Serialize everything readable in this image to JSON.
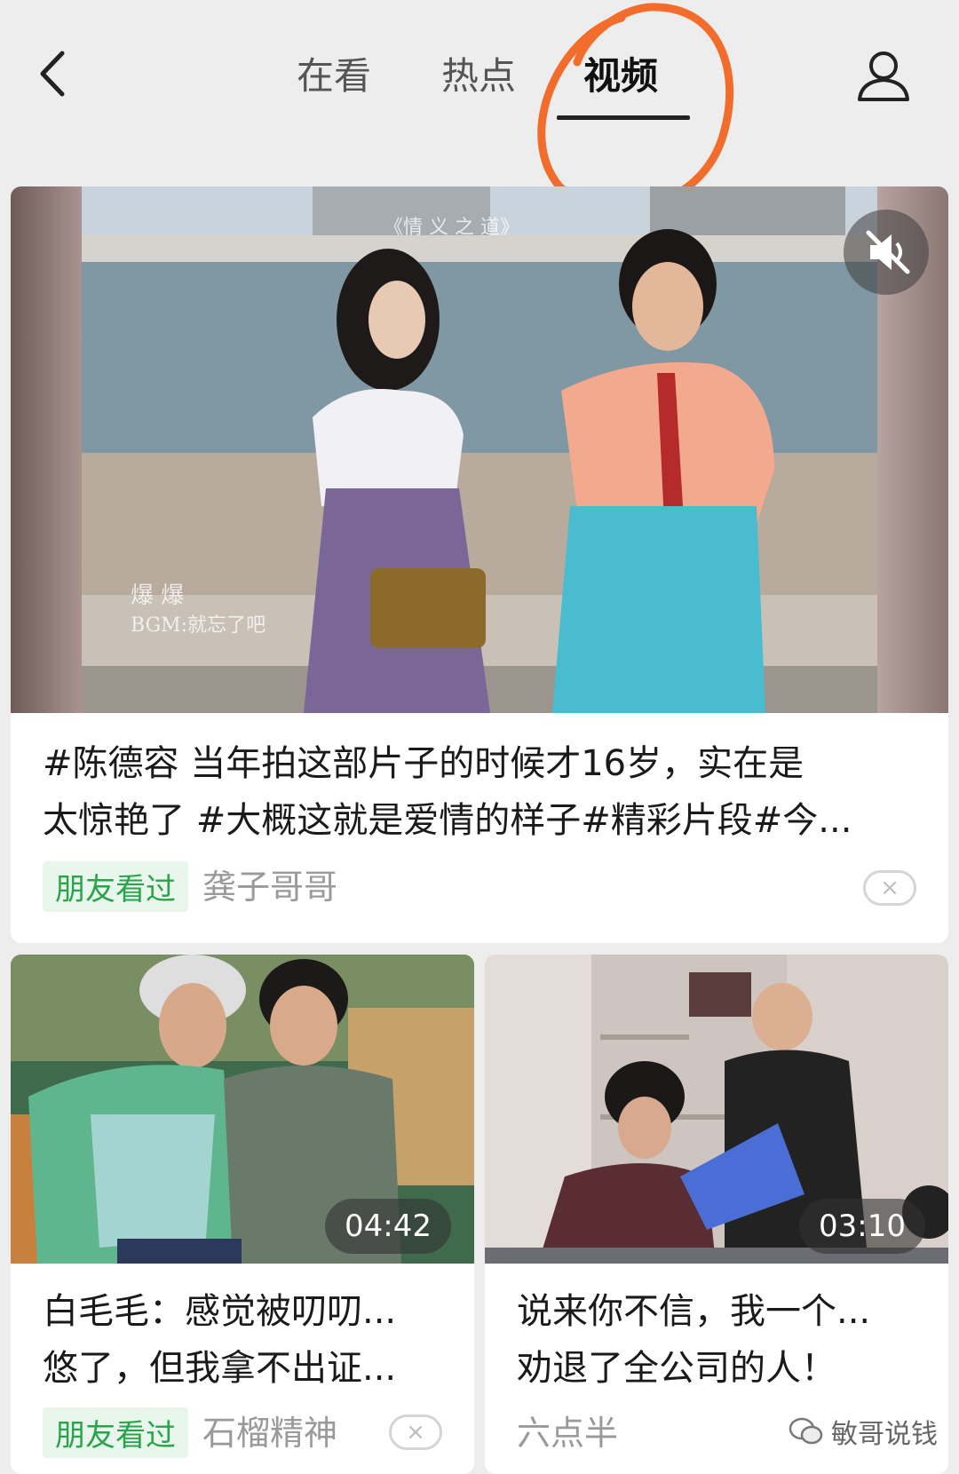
{
  "nav": {
    "tabs": [
      {
        "label": "在看"
      },
      {
        "label": "热点"
      },
      {
        "label": "视频",
        "active": true
      }
    ]
  },
  "featured": {
    "title_line1": "#陈德容 当年拍这部片子的时候才16岁，实在是",
    "title_line2": "太惊艳了 #大概这就是爱情的样子#精彩片段#今...",
    "badge": "朋友看过",
    "author": "龚子哥哥",
    "dismiss": "×",
    "video_watermark_1": "爆 爆",
    "video_watermark_2": "BGM:就忘了吧",
    "video_caption_top": "《情 义 之 道》"
  },
  "cards": [
    {
      "duration": "04:42",
      "title_line1": "白毛毛：感觉被叨叨...",
      "title_line2": "悠了，但我拿不出证...",
      "badge": "朋友看过",
      "author": "石榴精神",
      "dismiss": "×"
    },
    {
      "duration": "03:10",
      "title_line1": "说来你不信，我一个...",
      "title_line2": "劝退了全公司的人！",
      "author": "六点半"
    }
  ],
  "watermark": {
    "text": "敏哥说钱"
  },
  "icons": {
    "back": "chevron-left-icon",
    "profile": "user-icon",
    "mute": "speaker-muted-icon"
  },
  "colors": {
    "annotation": "#f26d2b",
    "badge_green": "#2aa44b",
    "background": "#ededed"
  }
}
